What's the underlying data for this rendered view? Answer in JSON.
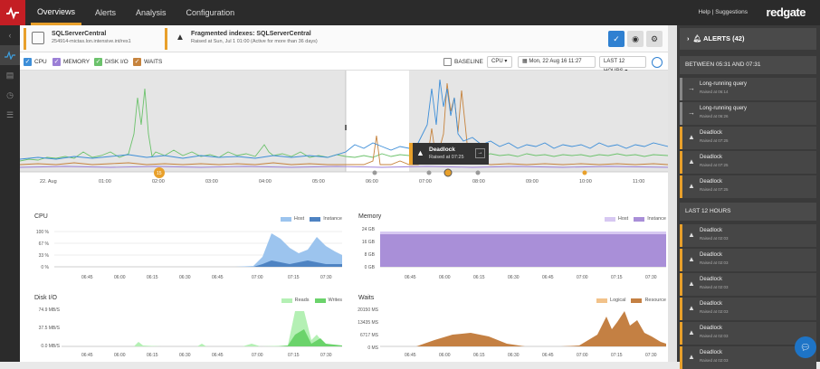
{
  "nav": {
    "tabs": [
      "Overviews",
      "Alerts",
      "Analysis",
      "Configuration"
    ],
    "active": 0
  },
  "topright": {
    "links": "Help | Suggestions",
    "brand": "redgate"
  },
  "server": {
    "name": "SQLServerCentral",
    "detail": "254914-mictas.lon.intensive.int/res1"
  },
  "alert_banner": {
    "title": "Fragmented indexes: SQLServerCentral",
    "subtitle": "Raised at Sun, Jul 1 01:00 (Active for more than 36 days)"
  },
  "legend": [
    {
      "label": "CPU",
      "color": "#3d8ed8"
    },
    {
      "label": "MEMORY",
      "color": "#9b7fd6"
    },
    {
      "label": "DISK I/O",
      "color": "#6cc26c"
    },
    {
      "label": "WAITS",
      "color": "#c6833d"
    }
  ],
  "controls": {
    "baseline": "BASELINE",
    "metric": "CPU",
    "date": "Mon, 22 Aug 16   11:27",
    "range": "LAST 12 HOURS"
  },
  "timeline": {
    "labels": [
      "22. Aug",
      "01:00",
      "02:00",
      "03:00",
      "04:00",
      "05:00",
      "06:00",
      "07:00",
      "08:00",
      "09:00",
      "10:00",
      "11:00"
    ],
    "tooltip": {
      "title": "Deadlock",
      "subtitle": "Raised at 07:25"
    },
    "marker_count": "15"
  },
  "panels": [
    {
      "title": "CPU",
      "legend": [
        "Host",
        "Instance"
      ],
      "colors": [
        "#9cc4ee",
        "#4e83c2"
      ],
      "ylabels": [
        "100 %",
        "67 %",
        "33 %",
        "0 %"
      ]
    },
    {
      "title": "Memory",
      "legend": [
        "Host",
        "Instance"
      ],
      "colors": [
        "#d7c8f2",
        "#a98fd8"
      ],
      "ylabels": [
        "24 GB",
        "16 GB",
        "8 GB",
        "0 GB"
      ]
    },
    {
      "title": "Disk I/O",
      "legend": [
        "Reads",
        "Writes"
      ],
      "colors": [
        "#b4f0b4",
        "#6bd36b"
      ],
      "ylabels": [
        "74.9 MB/S",
        "37.5 MB/S",
        "0.0 MB/S"
      ]
    },
    {
      "title": "Waits",
      "legend": [
        "Logical",
        "Resource"
      ],
      "colors": [
        "#f2c28a",
        "#c48043"
      ],
      "ylabels": [
        "20150 MS",
        "13435 MS",
        "6717 MS",
        "0 MS"
      ]
    }
  ],
  "panel_xlabels": [
    "06:45",
    "06:00",
    "06:15",
    "06:30",
    "06:45",
    "07:00",
    "07:15",
    "07:30"
  ],
  "alerts_panel": {
    "title": "ALERTS (42)",
    "section1": "BETWEEN 05:31 AND 07:31",
    "section2": "LAST 12 HOURS",
    "items1": [
      {
        "title": "Long-running query",
        "sub": "Raised at 06:14",
        "color": "grey"
      },
      {
        "title": "Long-running query",
        "sub": "Raised at 06:26",
        "color": "grey"
      },
      {
        "title": "Deadlock",
        "sub": "Raised at 07:25",
        "color": "orange"
      },
      {
        "title": "Deadlock",
        "sub": "Raised at 07:25",
        "color": "orange"
      },
      {
        "title": "Deadlock",
        "sub": "Raised at 07:25",
        "color": "orange"
      }
    ],
    "items2": [
      {
        "title": "Deadlock",
        "sub": "Raised at 02:03"
      },
      {
        "title": "Deadlock",
        "sub": "Raised at 02:03"
      },
      {
        "title": "Deadlock",
        "sub": "Raised at 02:03"
      },
      {
        "title": "Deadlock",
        "sub": "Raised at 02:03"
      },
      {
        "title": "Deadlock",
        "sub": "Raised at 02:03"
      },
      {
        "title": "Deadlock",
        "sub": "Raised at 02:03"
      }
    ]
  }
}
